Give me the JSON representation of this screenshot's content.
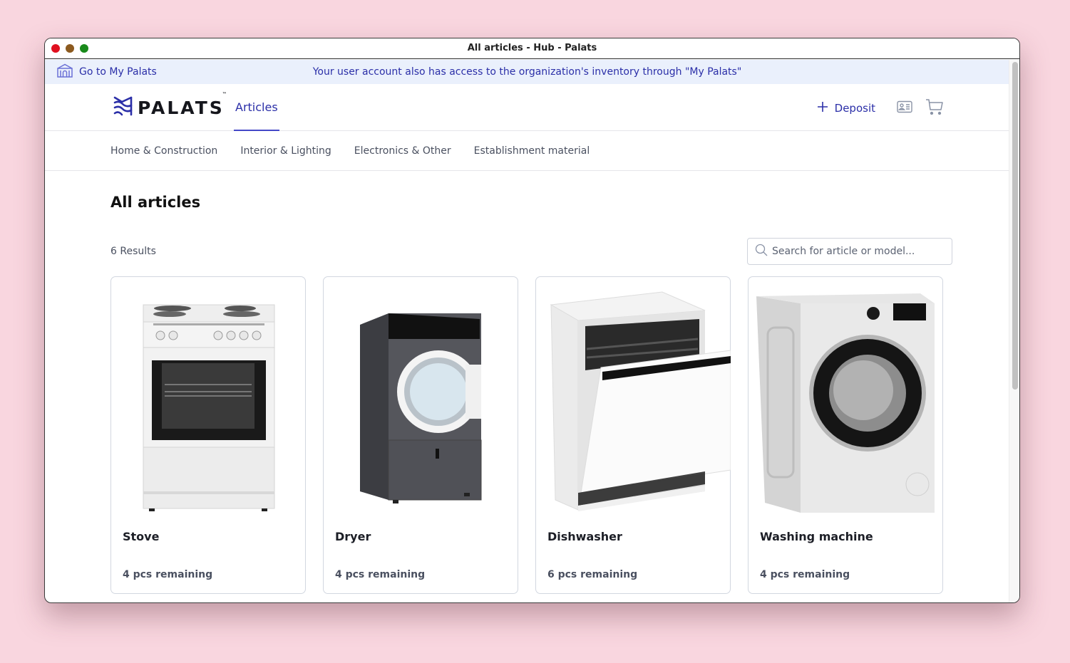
{
  "window": {
    "title": "All articles - Hub - Palats"
  },
  "banner": {
    "link_label": "Go to My Palats",
    "message": "Your user account also has access to the organization's inventory through \"My Palats\"",
    "link_icon": "building-icon"
  },
  "header": {
    "logo_text": "PALATS",
    "logo_tm": "™",
    "nav_active": "Articles",
    "deposit_label": "Deposit",
    "icons": [
      "plus-icon",
      "id-card-icon",
      "cart-icon"
    ]
  },
  "categories": [
    "Home & Construction",
    "Interior & Lighting",
    "Electronics & Other",
    "Establishment material"
  ],
  "main": {
    "title": "All articles",
    "results_count": "6 Results",
    "search": {
      "placeholder": "Search for article or model...",
      "value": ""
    },
    "articles": [
      {
        "name": "Stove",
        "stock": "4 pcs remaining",
        "image": "stove"
      },
      {
        "name": "Dryer",
        "stock": "4 pcs remaining",
        "image": "dryer"
      },
      {
        "name": "Dishwasher",
        "stock": "6 pcs remaining",
        "image": "dishwasher"
      },
      {
        "name": "Washing machine",
        "stock": "4 pcs remaining",
        "image": "washing-machine"
      }
    ]
  },
  "colors": {
    "brand": "#2b2fa8",
    "banner_bg": "#eaf0fc",
    "desktop_bg": "#f9d6df"
  }
}
